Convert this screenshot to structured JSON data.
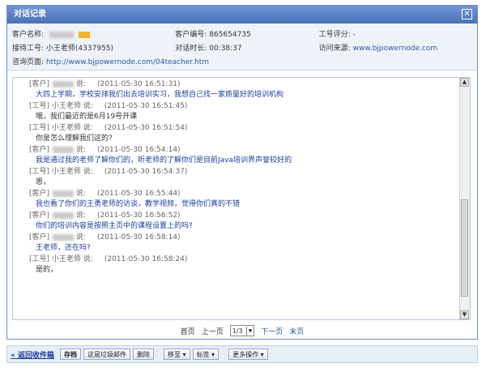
{
  "title": "对话记录",
  "close_glyph": "✕",
  "info": {
    "customer_name_label": "客户名称:",
    "customer_id_label": "客户编号:",
    "customer_id_value": "865654735",
    "rating_label": "工号评分:",
    "rating_value": "-",
    "staff_label": "接待工号:",
    "staff_value": "小王老师(4337955)",
    "duration_label": "对话时长:",
    "duration_value": "00:38:37",
    "source_label": "访问来源:",
    "source_value": "www.bjpowernode.com",
    "page_label": "咨询页面:",
    "page_value": "http://www.bjpowernode.com/04teacher.htm"
  },
  "messages": [
    {
      "who": "[客户]",
      "said": "说:",
      "time": "(2011-05-30 16:51:31)",
      "text": "大四上学期，学校安排我们出去培训实习，我想自己找一家质量好的培训机构",
      "type": "customer"
    },
    {
      "who": "[工号] 小王老师",
      "said": "说:",
      "time": "(2011-05-30 16:51:45)",
      "text": "哦，我们最近的是6月19号开课",
      "type": "staff"
    },
    {
      "who": "[工号] 小王老师",
      "said": "说:",
      "time": "(2011-05-30 16:51:54)",
      "text": "你是怎么理解我们这的?",
      "type": "staff"
    },
    {
      "who": "[客户]",
      "said": "说:",
      "time": "(2011-05-30 16:54:14)",
      "text": "我是通过我的老师了解你们的，听老师的了解你们是目前Java培训界声誉较好的",
      "type": "customer"
    },
    {
      "who": "[工号] 小王老师",
      "said": "说:",
      "time": "(2011-05-30 16:54:37)",
      "text": "恩，",
      "type": "staff"
    },
    {
      "who": "[客户]",
      "said": "说:",
      "time": "(2011-05-30 16:55:44)",
      "text": "我也看了你们的王勇老师的访谈，教学视频，觉得你们真的不错",
      "type": "customer"
    },
    {
      "who": "[客户]",
      "said": "说:",
      "time": "(2011-05-30 16:56:52)",
      "text": "你们的培训内容是按照主页中的课程设置上的吗?",
      "type": "customer"
    },
    {
      "who": "[客户]",
      "said": "说:",
      "time": "(2011-05-30 16:58:14)",
      "text": "王老师，还在吗?",
      "type": "customer"
    },
    {
      "who": "[工号] 小王老师",
      "said": "说:",
      "time": "(2011-05-30 16:58:24)",
      "text": "是的，",
      "type": "staff"
    }
  ],
  "pager": {
    "first": "首页",
    "prev": "上一页",
    "page_select": "1/3",
    "next": "下一页",
    "last": "末页"
  },
  "toolbar": {
    "back": "« 返回收件箱",
    "archive": "存档",
    "spam": "这是垃圾邮件",
    "delete": "删除",
    "move": "移至 ▾",
    "tag": "标签 ▾",
    "more": "更多操作 ▾"
  }
}
